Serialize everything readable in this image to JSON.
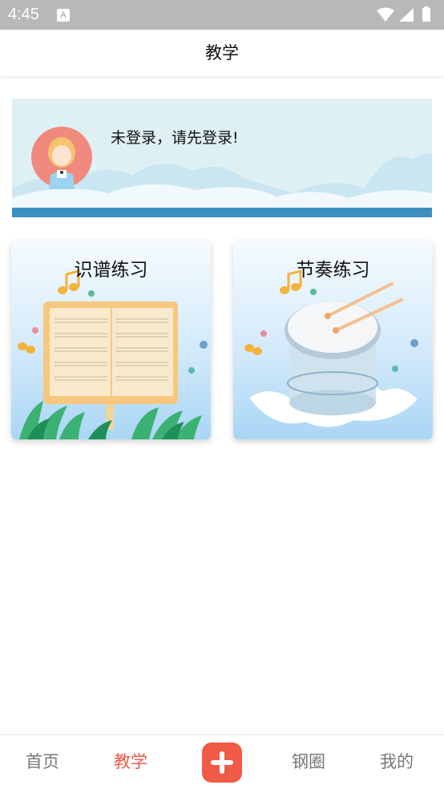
{
  "status_bar": {
    "time": "4:45",
    "notification_badge": "A",
    "icons": [
      "wifi-icon",
      "cellular-signal-icon",
      "battery-icon"
    ]
  },
  "header": {
    "title": "教学"
  },
  "login_banner": {
    "message": "未登录，请先登录!",
    "avatar_icon": "girl-avatar-icon"
  },
  "practice_cards": [
    {
      "title": "识谱练习",
      "illustration": "sheet-music-book-icon"
    },
    {
      "title": "节奏练习",
      "illustration": "drum-icon"
    }
  ],
  "bottom_nav": {
    "items": [
      {
        "label": "首页",
        "active": false
      },
      {
        "label": "教学",
        "active": true
      },
      {
        "label": "",
        "icon": "plus-icon",
        "active": false
      },
      {
        "label": "钢圈",
        "active": false
      },
      {
        "label": "我的",
        "active": false
      }
    ]
  },
  "colors": {
    "accent": "#f05a47",
    "status_bar": "#b8b8b8",
    "banner_bg": "#dff0f4",
    "banner_stripe": "#3b8fbf",
    "nav_inactive": "#777777"
  }
}
